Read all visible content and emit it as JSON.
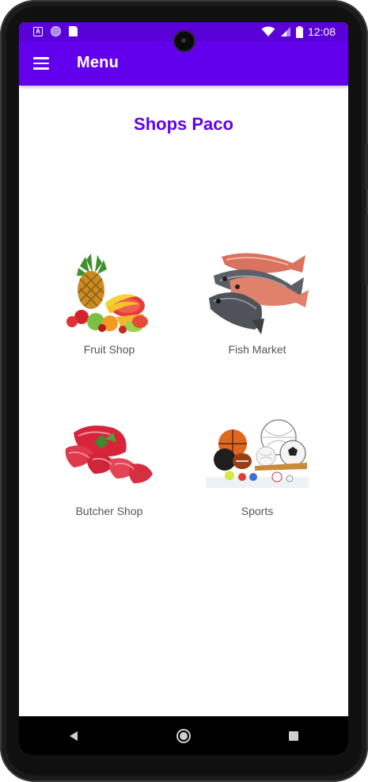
{
  "status_bar": {
    "time": "12:08",
    "left_icons": [
      "a-notification-icon",
      "circle-notification-icon",
      "sd-card-icon"
    ],
    "right_icons": [
      "wifi-icon",
      "cell-signal-icon",
      "battery-icon"
    ]
  },
  "app_bar": {
    "title": "Menu",
    "menu_icon": "hamburger-menu-icon"
  },
  "page": {
    "title": "Shops Paco"
  },
  "shops": [
    {
      "label": "Fruit Shop",
      "icon": "fruit-image"
    },
    {
      "label": "Fish Market",
      "icon": "fish-image"
    },
    {
      "label": "Butcher Shop",
      "icon": "meat-image"
    },
    {
      "label": "Sports",
      "icon": "sports-balls-image"
    }
  ],
  "nav_bar": {
    "buttons": [
      "back-icon",
      "home-icon",
      "recents-icon"
    ]
  },
  "colors": {
    "primary": "#6200ee",
    "status_bar": "#5a00d8",
    "title_text": "#6200ee"
  }
}
